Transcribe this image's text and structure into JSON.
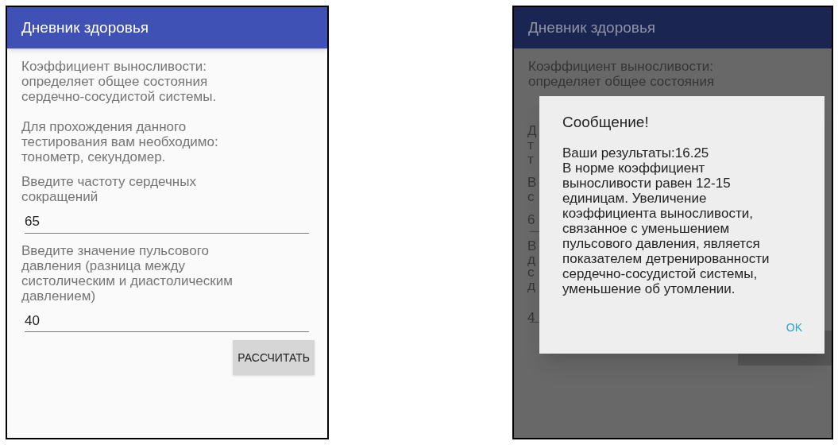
{
  "form_screen": {
    "app_bar": {
      "title": "Дневник здоровья"
    },
    "paragraphs": [
      "Коэффициент выносливости: определяет общее состояния сердечно-сосудистой системы.",
      "Для прохождения данного тестирования вам необходимо: тонометр, секундомер."
    ],
    "fields": [
      {
        "label": "Введите частоту сердечных сокращений",
        "value": "65"
      },
      {
        "label": "Введите значение пульсового давления (разница между систолическим и диастолическим давлением)",
        "value": "40"
      }
    ],
    "button": "РАССЧИТАТЬ"
  },
  "dialog_screen": {
    "app_bar": {
      "title": "Дневник здоровья"
    },
    "background_lines": [
      "Коэффициент выносливости:",
      "определяет общее состояния"
    ],
    "background_fragments": [
      "Д",
      "т",
      "т",
      "В",
      "с",
      "6",
      "В",
      "д",
      "с",
      "д",
      "4"
    ],
    "dialog": {
      "title": "Сообщение!",
      "message": "Ваши результаты:16.25\nВ норме коэффициент выносливости равен 12-15 единицам. Увеличение коэффициента выносливости, связанное с уменьшением пульсового давления, является показателем детренированности сердечно-сосудистой системы, уменьшение об утомлении.",
      "button": "OK"
    }
  }
}
